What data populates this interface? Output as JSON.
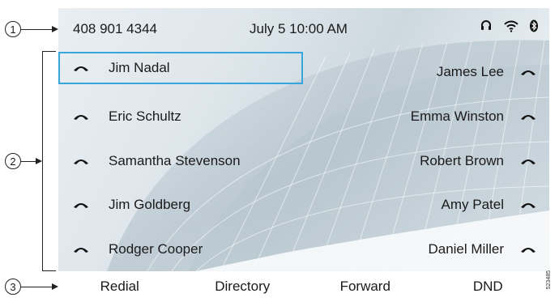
{
  "callouts": [
    "1",
    "2",
    "3"
  ],
  "status_bar": {
    "phone_number": "408 901 4344",
    "datetime": "July 5 10:00 AM",
    "icons": [
      "headset-icon",
      "wifi-icon",
      "bluetooth-icon"
    ]
  },
  "lines_left": [
    {
      "label": "Jim Nadal",
      "selected": true
    },
    {
      "label": "Eric Schultz"
    },
    {
      "label": "Samantha Stevenson"
    },
    {
      "label": "Jim Goldberg"
    },
    {
      "label": "Rodger Cooper"
    }
  ],
  "lines_right": [
    {
      "label": "James Lee"
    },
    {
      "label": "Emma Winston"
    },
    {
      "label": "Robert Brown"
    },
    {
      "label": "Amy Patel"
    },
    {
      "label": "Daniel Miller"
    }
  ],
  "softkeys": [
    "Redial",
    "Directory",
    "Forward",
    "DND"
  ],
  "figure_id": "523485",
  "colors": {
    "selection": "#37a6dd",
    "text": "#1a1a1a"
  }
}
